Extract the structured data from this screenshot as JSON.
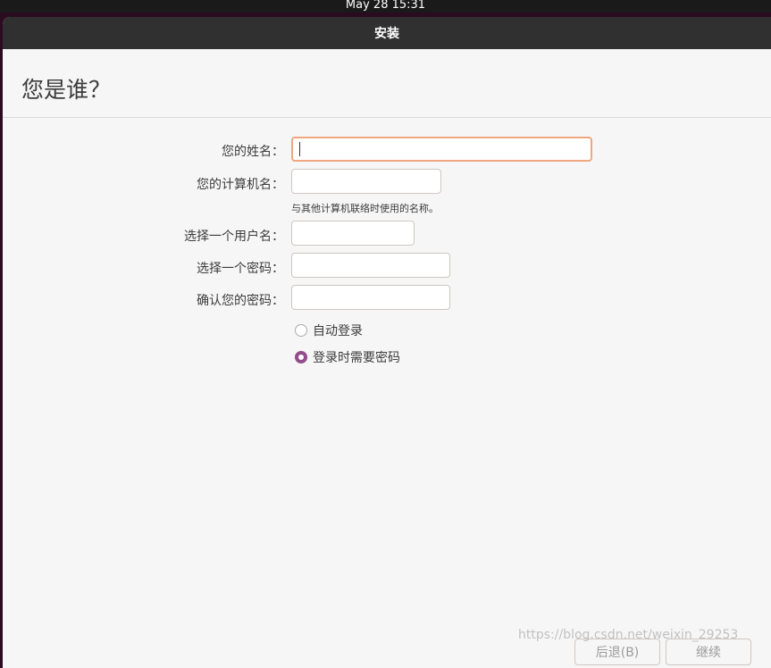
{
  "topbar": {
    "datetime": "May 28  15:31"
  },
  "window": {
    "title": "安装"
  },
  "page": {
    "title": "您是谁？"
  },
  "form": {
    "name_label": "您的姓名：",
    "name_value": "",
    "computer_label": "您的计算机名：",
    "computer_value": "",
    "computer_hint": "与其他计算机联络时使用的名称。",
    "username_label": "选择一个用户名：",
    "username_value": "",
    "password_label": "选择一个密码：",
    "confirm_label": "确认您的密码：",
    "login_options": [
      {
        "label": "自动登录",
        "selected": false
      },
      {
        "label": "登录时需要密码",
        "selected": true
      }
    ]
  },
  "buttons": {
    "back": "后退(B)",
    "continue": "继续"
  },
  "watermark": "https://blog.csdn.net/weixin_29253",
  "colors": {
    "accent": "#924d8b",
    "focus": "#f0a77f",
    "titlebar": "#303030"
  }
}
